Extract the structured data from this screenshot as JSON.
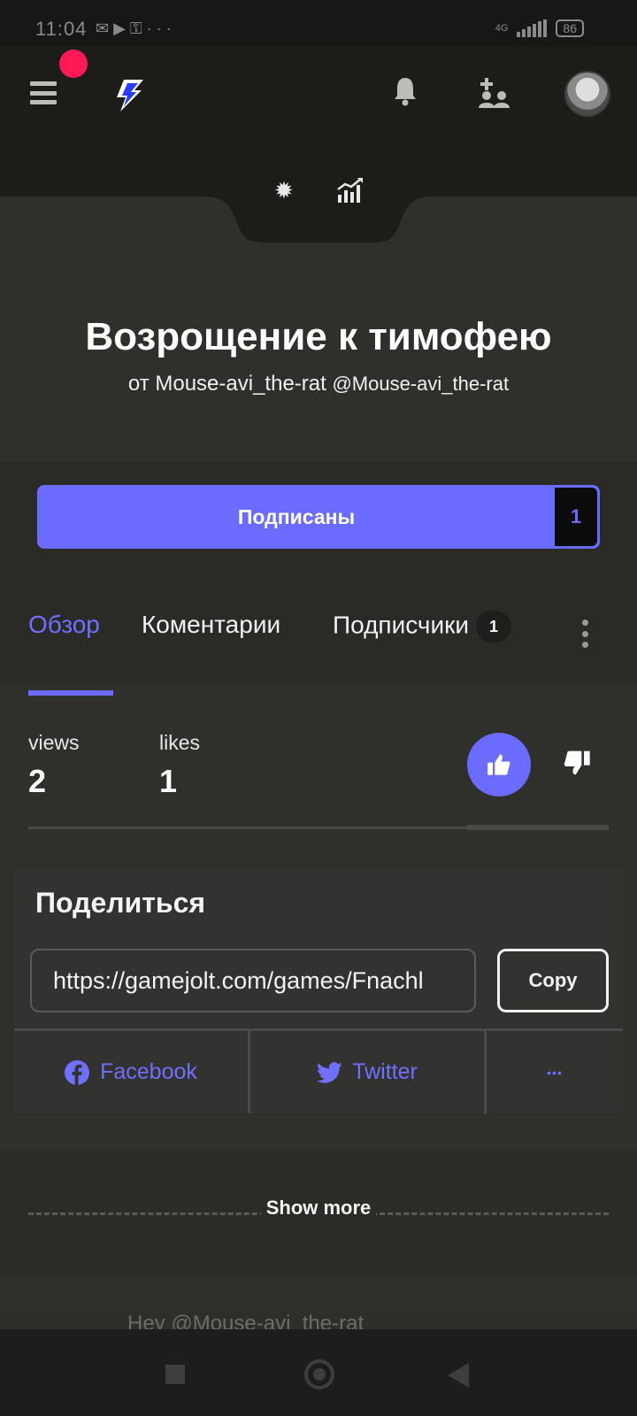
{
  "statusbar": {
    "time": "11:04",
    "icons": "✉ ▶ ⚿  · · ·",
    "network": "4G",
    "battery": "86"
  },
  "topbar": {
    "menu_icon": "hamburger-icon",
    "logo_icon": "gamejolt-logo-icon",
    "bell_icon": "bell-icon",
    "add_friend_icon": "add-friend-icon",
    "avatar_icon": "user-avatar"
  },
  "tools": {
    "settings_icon": "gear-icon",
    "analytics_icon": "analytics-icon"
  },
  "game": {
    "title": "Возрощение к тимофею",
    "by": "от Mouse-avi_the-rat",
    "handle": "@Mouse-avi_the-rat"
  },
  "follow": {
    "label": "Подписаны",
    "count": "1"
  },
  "tabs": [
    {
      "label": "Обзор"
    },
    {
      "label": "Коментарии"
    },
    {
      "label": "Подписчики",
      "badge": "1"
    }
  ],
  "stats": {
    "views_label": "views",
    "views_value": "2",
    "likes_label": "likes",
    "likes_value": "1"
  },
  "share": {
    "title": "Поделиться",
    "url": "https://gamejolt.com/games/Fnachl",
    "copy_label": "Copy",
    "facebook_label": "Facebook",
    "twitter_label": "Twitter",
    "more_label": "•••"
  },
  "show_more_label": "Show more",
  "comment_preview": "Hey @Mouse-avi_the-rat",
  "colors": {
    "accent": "#6b6bff",
    "notification": "#ff1a55",
    "background": "#2f2f2b"
  }
}
